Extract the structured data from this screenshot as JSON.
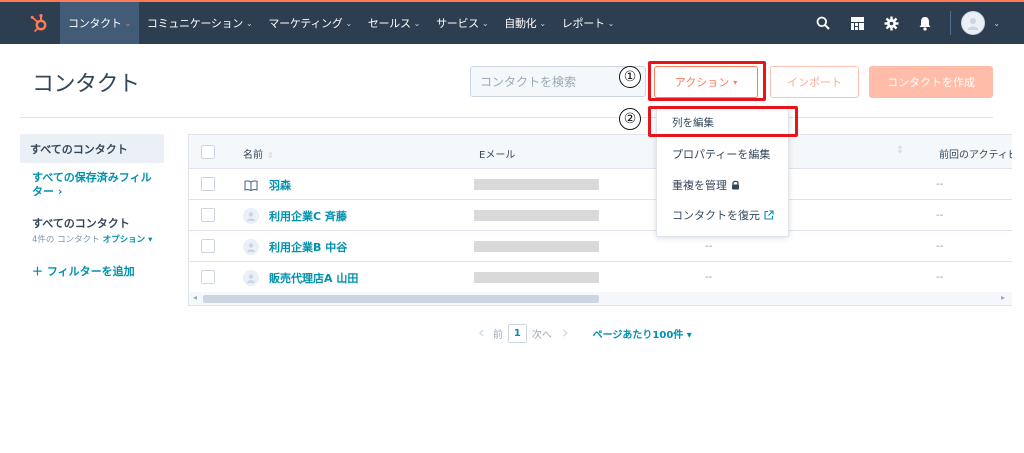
{
  "colors": {
    "nav_bg": "#2d3e50",
    "accent": "#ff7a59",
    "link": "#0091ae",
    "annotation_red": "#e8141b"
  },
  "nav": {
    "items": [
      {
        "label": "コンタクト",
        "active": true
      },
      {
        "label": "コミュニケーション"
      },
      {
        "label": "マーケティング"
      },
      {
        "label": "セールス"
      },
      {
        "label": "サービス"
      },
      {
        "label": "自動化"
      },
      {
        "label": "レポート"
      }
    ],
    "right_icons": [
      "search-icon",
      "marketplace-icon",
      "settings-icon",
      "notifications-icon",
      "avatar",
      "chevron-down-icon"
    ]
  },
  "header": {
    "title": "コンタクト",
    "search_placeholder": "コンタクトを検索",
    "action_label": "アクション",
    "import_label": "インポート",
    "create_label": "コンタクトを作成"
  },
  "annotations": {
    "step1": "①",
    "step2": "②"
  },
  "sidebar": {
    "active_view": "すべてのコンタクト",
    "saved_filters": "すべての保存済みフィルター ›",
    "current_title": "すべてのコンタクト",
    "count_text": "4件の コンタクト",
    "options_label": "オプション ▾",
    "add_filter": "＋  フィルターを追加"
  },
  "table": {
    "columns": {
      "name": "名前",
      "email": "Eメール",
      "last_activity": "前回のアクティビ"
    },
    "rows": [
      {
        "name": "羽森",
        "icon": "book-icon",
        "col3": "",
        "col5": "--"
      },
      {
        "name": "利用企業C 斉藤",
        "icon": "person-avatar",
        "col3": "",
        "col5": "--"
      },
      {
        "name": "利用企業B 中谷",
        "icon": "person-avatar",
        "col3": "--",
        "col5": "--"
      },
      {
        "name": "販売代理店A 山田",
        "icon": "person-avatar",
        "col3": "--",
        "col5": "--"
      }
    ]
  },
  "dropdown": {
    "items": [
      {
        "label": "列を編集"
      },
      {
        "label": "プロパティーを編集"
      },
      {
        "label": "重複を管理",
        "icon": "lock-icon"
      },
      {
        "label": "コンタクトを復元",
        "icon": "external-link-icon"
      }
    ]
  },
  "pagination": {
    "prev_label": "前",
    "page": "1",
    "next_label": "次へ",
    "per_page": "ページあたり100件 ▾"
  }
}
